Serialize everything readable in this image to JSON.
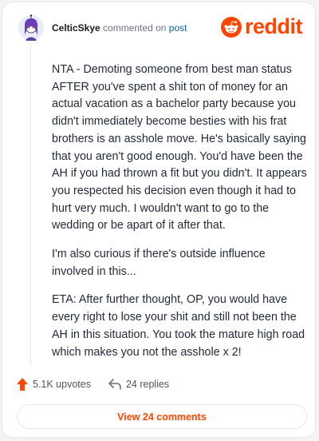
{
  "comment": {
    "username": "CelticSkye",
    "action_text": "commented on",
    "post_link": "post",
    "paragraphs": [
      "NTA - Demoting someone from best man status AFTER you've spent a shit ton of money for an actual vacation as a bachelor party because you didn't immediately become besties with his frat brothers is an asshole move. He's basically saying that you aren't good enough. You'd have been the AH if you had thrown a fit but you didn't. It appears you respected his decision even though it had to hurt very much. I wouldn't want to go to the wedding or be apart of it after that.",
      "I'm also curious if there's outside influence involved in this...",
      "ETA: After further thought, OP, you would have every right to lose your shit and still not been the AH in this situation. You took the mature high road which makes you not the asshole x 2!"
    ],
    "upvotes": "5.1K upvotes",
    "replies": "24 replies",
    "view_comments": "View 24 comments"
  },
  "brand": {
    "wordmark": "reddit",
    "accent_color": "#ff4500"
  },
  "icons": {
    "avatar": "snoo-avatar-icon",
    "logo": "reddit-snoo-icon",
    "upvote": "upvote-arrow-icon",
    "reply": "reply-arrow-icon"
  }
}
